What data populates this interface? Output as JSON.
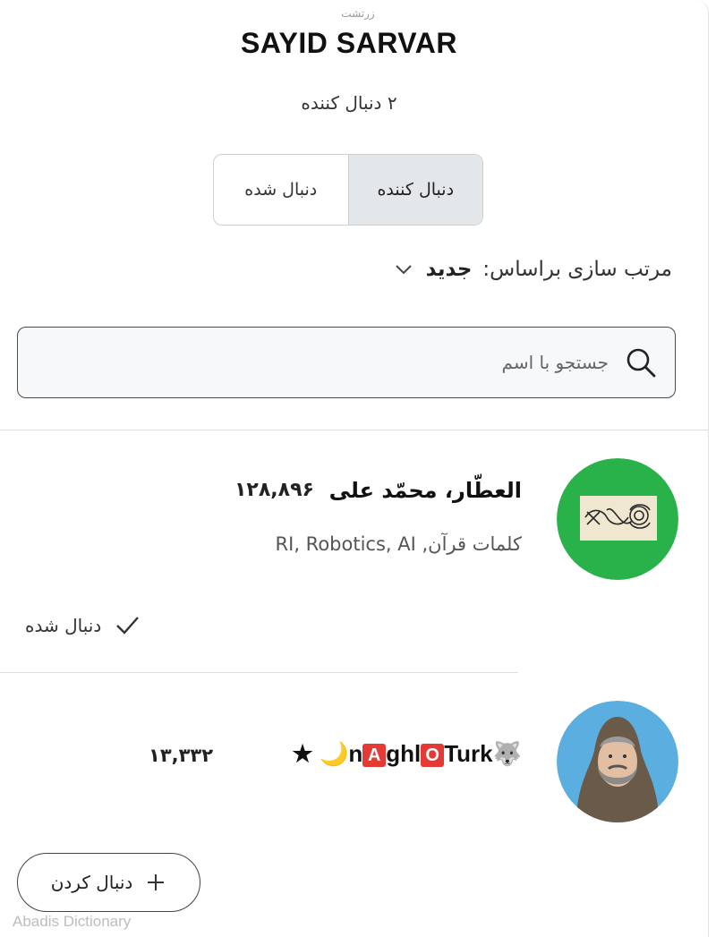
{
  "header": {
    "section_label": "زرتشت",
    "profile_name": "SAYID SARVAR",
    "follower_count_text": "۲ دنبال کننده"
  },
  "tabs": [
    {
      "label": "دنبال کننده",
      "active": true
    },
    {
      "label": "دنبال شده",
      "active": false
    }
  ],
  "sort": {
    "label": "مرتب سازی براساس:",
    "value": "جدید",
    "icon": "chevron-down-icon"
  },
  "search": {
    "placeholder": "جستجو با اسم",
    "icon": "search-icon"
  },
  "users": [
    {
      "name": "العطّار، محمّد علی",
      "score": "۱۲۸,۸۹۶",
      "tags": "کلمات قرآن, RI, Robotics, AI",
      "status_label": "دنبال شده",
      "status_icon": "checkmark-icon",
      "avatar_bg": "#2ab24a"
    },
    {
      "name_parts": [
        "🐺",
        "n",
        "A",
        "ghl",
        "O",
        "Turk",
        "🌙",
        "★"
      ],
      "score": "۱۳,۳۳۲",
      "action_label": "دنبال کردن",
      "action_icon": "plus-icon",
      "avatar_bg": "#5aaee0"
    }
  ],
  "watermark": "Abadis Dictionary"
}
